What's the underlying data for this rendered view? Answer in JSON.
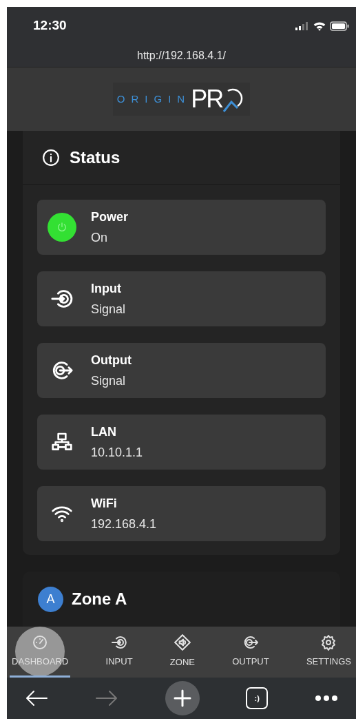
{
  "status_bar": {
    "time": "12:30"
  },
  "browser": {
    "url": "http://192.168.4.1/",
    "tabs_label": ":)",
    "forward_disabled": true
  },
  "logo": {
    "word": "ORIGIN",
    "mark": "PR"
  },
  "status_panel": {
    "title": "Status",
    "items": [
      {
        "kind": "power",
        "label": "Power",
        "value": "On",
        "on": true
      },
      {
        "kind": "input",
        "label": "Input",
        "value": "Signal"
      },
      {
        "kind": "output",
        "label": "Output",
        "value": "Signal"
      },
      {
        "kind": "lan",
        "label": "LAN",
        "value": "10.10.1.1"
      },
      {
        "kind": "wifi",
        "label": "WiFi",
        "value": "192.168.4.1"
      }
    ]
  },
  "zone_panel": {
    "badge": "A",
    "title": "Zone A"
  },
  "nav_tabs": [
    {
      "kind": "dashboard",
      "label": "DASHBOARD",
      "selected": true
    },
    {
      "kind": "input",
      "label": "INPUT",
      "selected": false
    },
    {
      "kind": "zone",
      "label": "ZONE",
      "selected": false
    },
    {
      "kind": "output",
      "label": "OUTPUT",
      "selected": false
    },
    {
      "kind": "settings",
      "label": "SETTINGS",
      "selected": false
    }
  ]
}
